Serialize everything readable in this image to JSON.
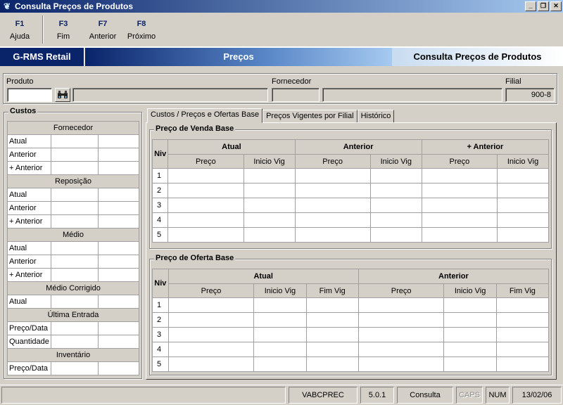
{
  "window": {
    "title": "Consulta Preços de Produtos",
    "icon": "app-leaf-icon",
    "buttons": [
      "minimize",
      "restore",
      "close"
    ]
  },
  "fkeys": [
    {
      "key": "F1",
      "label": "Ajuda"
    },
    {
      "key": "F3",
      "label": "Fim"
    },
    {
      "key": "F7",
      "label": "Anterior"
    },
    {
      "key": "F8",
      "label": "Próximo"
    }
  ],
  "banner": {
    "brand": "G-RMS Retail",
    "module": "Preços",
    "screen": "Consulta Preços de Produtos"
  },
  "filters": {
    "produto_label": "Produto",
    "produto_value": "",
    "fornecedor_label": "Fornecedor",
    "filial_label": "Filial",
    "filial_value": "900-8",
    "search_icon": "binoculars-icon"
  },
  "custos": {
    "title": "Custos",
    "sections": [
      {
        "header": "Fornecedor",
        "rows": [
          "Atual",
          "Anterior",
          "+ Anterior"
        ]
      },
      {
        "header": "Reposição",
        "rows": [
          "Atual",
          "Anterior",
          "+ Anterior"
        ]
      },
      {
        "header": "Médio",
        "rows": [
          "Atual",
          "Anterior",
          "+ Anterior"
        ]
      },
      {
        "header": "Médio Corrigido",
        "rows": [
          "Atual"
        ]
      },
      {
        "header": "Última Entrada",
        "rows": [
          "Preço/Data",
          "Quantidade"
        ]
      },
      {
        "header": "Inventário",
        "rows": [
          "Preço/Data"
        ]
      }
    ]
  },
  "tabs": [
    {
      "label": "Custos / Preços e Ofertas Base",
      "active": true
    },
    {
      "label": "Preços Vigentes por Filial",
      "active": false
    },
    {
      "label": "Histórico",
      "active": false
    }
  ],
  "venda": {
    "title": "Preço de Venda Base",
    "niv": "Niv",
    "groups": [
      "Atual",
      "Anterior",
      "+ Anterior"
    ],
    "cols": [
      "Preço",
      "Inicio Vig",
      "Preço",
      "Inicio Vig",
      "Preço",
      "Inicio Vig"
    ],
    "rows": [
      "1",
      "2",
      "3",
      "4",
      "5"
    ]
  },
  "oferta": {
    "title": "Preço de Oferta Base",
    "niv": "Niv",
    "groups": [
      "Atual",
      "Anterior"
    ],
    "cols": [
      "Preço",
      "Inicio Vig",
      "Fim Vig",
      "Preço",
      "Inicio Vig",
      "Fim Vig"
    ],
    "rows": [
      "1",
      "2",
      "3",
      "4",
      "5"
    ]
  },
  "status": {
    "program": "VABCPREC",
    "version": "5.0.1",
    "mode": "Consulta",
    "caps": "CAPS",
    "num": "NUM",
    "date": "13/02/06"
  },
  "colors": {
    "title_start": "#0a246a",
    "title_end": "#a6caf0",
    "face": "#d4d0c8",
    "fkey_color": "#0a246a"
  }
}
